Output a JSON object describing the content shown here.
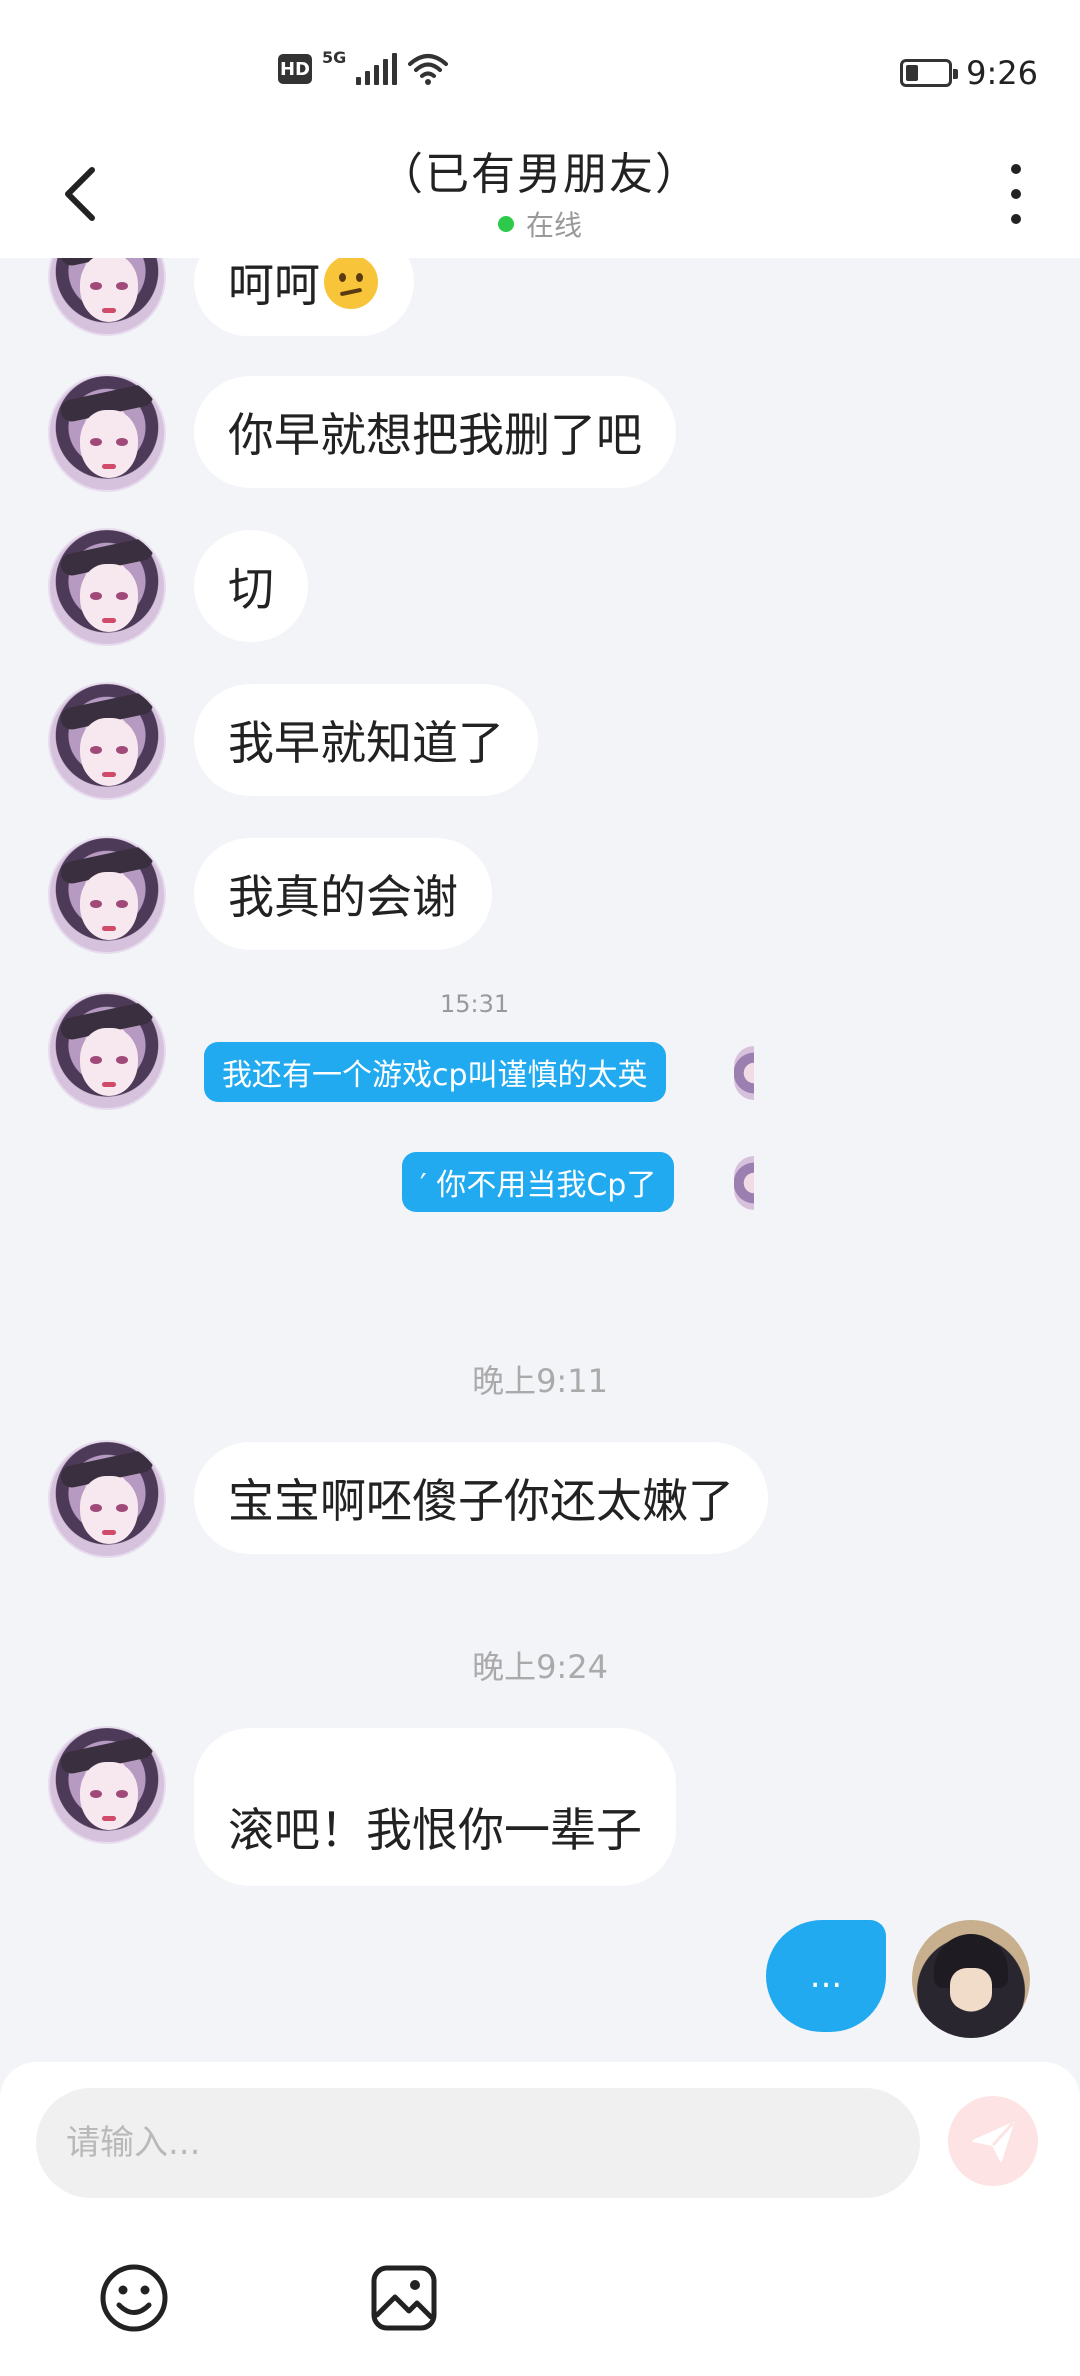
{
  "status_bar": {
    "hd": "HD",
    "network": "5G",
    "time": "9:26",
    "battery_level": 0.3
  },
  "header": {
    "title": "（已有男朋友）",
    "status": "在线",
    "online_color": "#2ec84a",
    "icons": [
      "back-arrow-icon",
      "more-vertical-icon"
    ]
  },
  "messages": [
    {
      "from": "them",
      "text": "呵呵",
      "emoji": "confused-face-emoji"
    },
    {
      "from": "them",
      "text": "你早就想把我删了吧"
    },
    {
      "from": "them",
      "text": "切"
    },
    {
      "from": "them",
      "text": "我早就知道了"
    },
    {
      "from": "them",
      "text": "我真的会谢"
    },
    {
      "from": "them",
      "type": "image",
      "time": "15:31",
      "lines": [
        "我还有一个游戏cp叫谨慎的太英",
        "′ 你不用当我Cp了"
      ]
    },
    {
      "from": "time",
      "text": "晚上9:11"
    },
    {
      "from": "them",
      "text": "宝宝啊呸傻子你还太嫩了"
    },
    {
      "from": "time",
      "text": "晚上9:24"
    },
    {
      "from": "them",
      "text": "滚吧！我恨你一辈子"
    },
    {
      "from": "me",
      "type": "typing",
      "text": "..."
    }
  ],
  "input": {
    "placeholder": "请输入..."
  },
  "toolbar": {
    "icons": [
      "emoji-icon",
      "image-icon",
      "send-icon"
    ]
  },
  "colors": {
    "accent": "#22aaf0",
    "background": "#f3f4f8",
    "send_disabled": "#fde3e3"
  }
}
